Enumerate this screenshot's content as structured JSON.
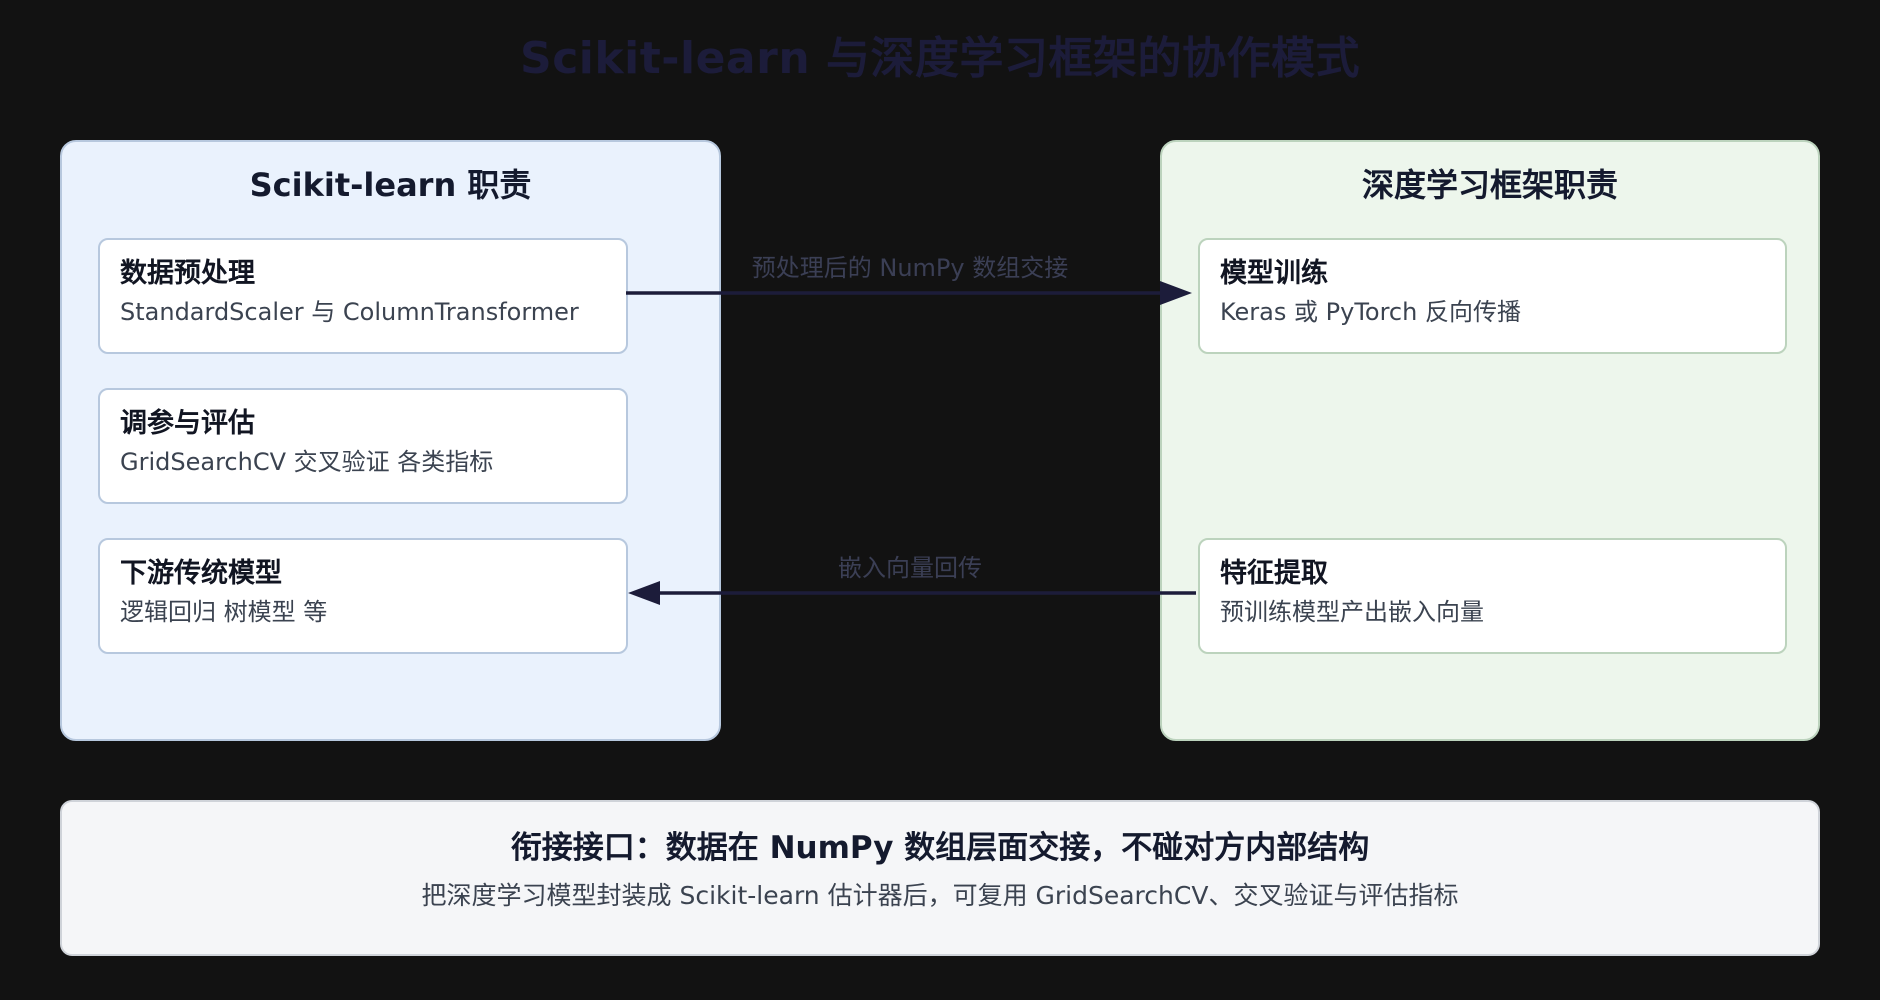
{
  "title": "Scikit-learn 与深度学习框架的协作模式",
  "left_panel": {
    "title": "Scikit-learn 职责",
    "cards": [
      {
        "title": "数据预处理",
        "desc": "StandardScaler 与 ColumnTransformer"
      },
      {
        "title": "调参与评估",
        "desc": "GridSearchCV 交叉验证 各类指标"
      },
      {
        "title": "下游传统模型",
        "desc": "逻辑回归 树模型 等"
      }
    ]
  },
  "right_panel": {
    "title": "深度学习框架职责",
    "cards": [
      {
        "title": "模型训练",
        "desc": "Keras 或 PyTorch 反向传播"
      },
      {
        "title": "特征提取",
        "desc": "预训练模型产出嵌入向量"
      }
    ]
  },
  "arrows": {
    "forward_label": "预处理后的 NumPy 数组交接",
    "backward_label": "嵌入向量回传"
  },
  "bottom": {
    "title": "衔接接口：数据在 NumPy 数组层面交接，不碰对方内部结构",
    "desc": "把深度学习模型封装成 Scikit-learn 估计器后，可复用 GridSearchCV、交叉验证与评估指标"
  },
  "colors": {
    "background": "#121212",
    "left_panel_bg": "#eaf2fd",
    "right_panel_bg": "#edf6ec",
    "arrow": "#1c1c3a"
  }
}
